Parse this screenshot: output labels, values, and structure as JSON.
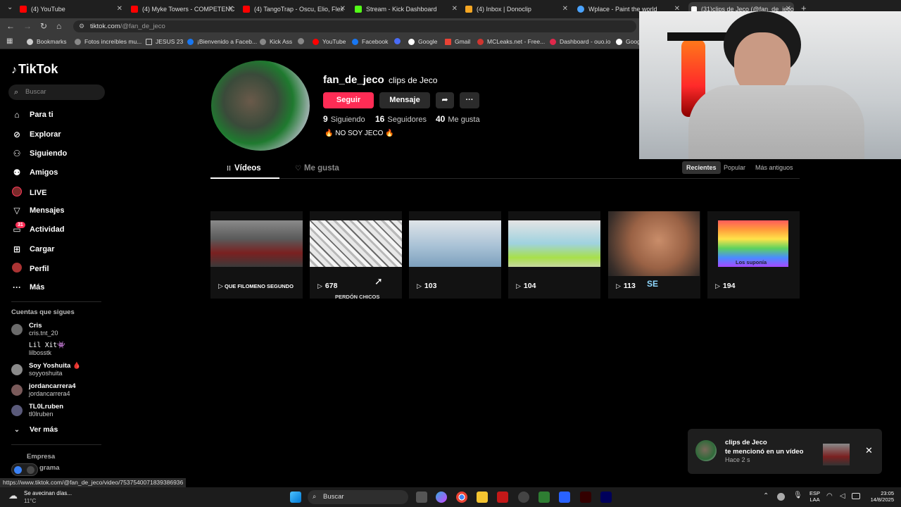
{
  "browser": {
    "tabs": [
      {
        "title": "(4) YouTube",
        "color": "#ff0000"
      },
      {
        "title": "(4) Myke Towers - COMPETENC",
        "color": "#ff0000"
      },
      {
        "title": "(4) TangoTrap - Oscu, Elio, Flex",
        "color": "#ff0000"
      },
      {
        "title": "Stream - Kick Dashboard",
        "color": "#53fc18"
      },
      {
        "title": "(4) Inbox | Donoclip",
        "color": "#f5a623"
      },
      {
        "title": "Wplace - Paint the world",
        "color": "#4aa3ff"
      },
      {
        "title": "(31)clips de Jeco (@fan_de_jeco",
        "color": "#ffffff"
      }
    ],
    "url_host": "tiktok.com",
    "url_path": "/@fan_de_jeco",
    "bookmarks": [
      {
        "label": "Bookmarks",
        "color": "#cccccc"
      },
      {
        "label": "Fotos increíbles mu...",
        "color": "#888888"
      },
      {
        "label": "JESUS 23",
        "color": "#888888"
      },
      {
        "label": "¡Bienvenido a Faceb...",
        "color": "#1877f2"
      },
      {
        "label": "Kick Ass",
        "color": "#888888"
      },
      {
        "label": "",
        "color": "#888888"
      },
      {
        "label": "YouTube",
        "color": "#ff0000"
      },
      {
        "label": "Facebook",
        "color": "#1877f2"
      },
      {
        "label": "",
        "color": "#4a6cf7"
      },
      {
        "label": "Google",
        "color": "#ffffff"
      },
      {
        "label": "Gmail",
        "color": "#ea4335"
      },
      {
        "label": "MCLeaks.net - Free...",
        "color": "#d0352f"
      },
      {
        "label": "Dashboard - ouo.io",
        "color": "#e0284b"
      },
      {
        "label": "Goog",
        "color": "#ffffff"
      }
    ]
  },
  "tiktok": {
    "logo": "TikTok",
    "search_placeholder": "Buscar",
    "nav": [
      {
        "label": "Para ti",
        "icon": "home-icon"
      },
      {
        "label": "Explorar",
        "icon": "compass-icon"
      },
      {
        "label": "Siguiendo",
        "icon": "following-icon"
      },
      {
        "label": "Amigos",
        "icon": "friends-icon"
      },
      {
        "label": "LIVE",
        "icon": "live-icon"
      },
      {
        "label": "Mensajes",
        "icon": "messages-icon"
      },
      {
        "label": "Actividad",
        "icon": "activity-icon",
        "badge": "31"
      },
      {
        "label": "Cargar",
        "icon": "upload-icon"
      },
      {
        "label": "Perfil",
        "icon": "profile-icon"
      },
      {
        "label": "Más",
        "icon": "more-icon"
      }
    ],
    "following_title": "Cuentas que sigues",
    "following": [
      {
        "name": "Cris",
        "user": "cris.tnt_20"
      },
      {
        "name": "Lil Xit👾",
        "user": "lilbosstk"
      },
      {
        "name": "Soy Yoshuita 🩸",
        "user": "soyyoshuita"
      },
      {
        "name": "jordancarrera4",
        "user": "jordancarrera4"
      },
      {
        "name": "TL0Lruben",
        "user": "tl0lruben"
      }
    ],
    "see_more": "Ver más",
    "footer_1": "Empresa",
    "footer_2": "grama"
  },
  "profile": {
    "username": "fan_de_jeco",
    "nickname": "clips de Jeco",
    "follow_label": "Seguir",
    "message_label": "Mensaje",
    "stats": [
      {
        "value": "9",
        "label": "Siguiendo"
      },
      {
        "value": "16",
        "label": "Seguidores"
      },
      {
        "value": "40",
        "label": "Me gusta"
      }
    ],
    "bio": "🔥 NO SOY JECO 🔥",
    "tab_videos": "Vídeos",
    "tab_likes": "Me gusta",
    "sort": [
      "Recientes",
      "Popular",
      "Más antiguos"
    ]
  },
  "videos": [
    {
      "views": "",
      "caption": "QUE FILOMENO SEGUNDO"
    },
    {
      "views": "678",
      "caption": "PERDÓN CHICOS"
    },
    {
      "views": "103",
      "caption": ""
    },
    {
      "views": "104",
      "caption": ""
    },
    {
      "views": "113",
      "caption": "SE"
    },
    {
      "views": "194",
      "caption": "Los suponía"
    }
  ],
  "notification": {
    "title": "clips de Jeco",
    "text": "te mencionó en un vídeo",
    "time": "Hace 2 s"
  },
  "status_url": "https://www.tiktok.com/@fan_de_jeco/video/7537540071839386936",
  "taskbar": {
    "weather_text": "Se avecinan días...",
    "weather_temp": "11°C",
    "search": "Buscar",
    "lang_1": "ESP",
    "lang_2": "LAA",
    "time": "23:05",
    "date": "14/8/2025"
  }
}
